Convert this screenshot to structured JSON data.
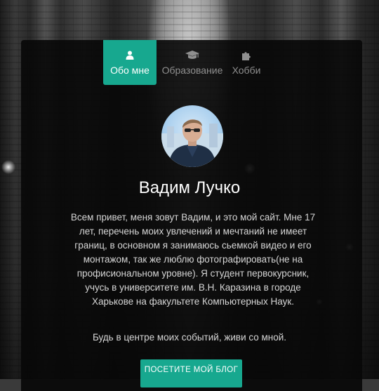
{
  "tabs": [
    {
      "label": "Обо мне",
      "icon": "user-icon",
      "active": true
    },
    {
      "label": "Образование",
      "icon": "graduation-cap-icon",
      "active": false
    },
    {
      "label": "Хобби",
      "icon": "puzzle-icon",
      "active": false
    }
  ],
  "profile": {
    "name": "Вадим Лучко",
    "bio_lines": [
      "Всем привет, меня зовут Вадим, и это мой сайт. Мне 17",
      "лет, перечень моих увлечений и мечтаний не имеет",
      "границ, в основном я занимаюсь сьемкой видео и его",
      "монтажом, так же люблю фотографировать(не на",
      "профисиональном уровне). Я студент первокурсник,",
      "учусь в университете им. В.Н. Каразина в городе",
      "Харькове на факультете Компьютерных Наук."
    ],
    "motto": "Будь в центре моих событий, живи со мной.",
    "blog_button": "ПОСЕТИТЕ МОЙ БЛОГ"
  },
  "colors": {
    "accent": "#17a88f",
    "card_bg": "#080808",
    "text": "#d6d6d6",
    "tab_inactive": "#8f8f8f"
  }
}
